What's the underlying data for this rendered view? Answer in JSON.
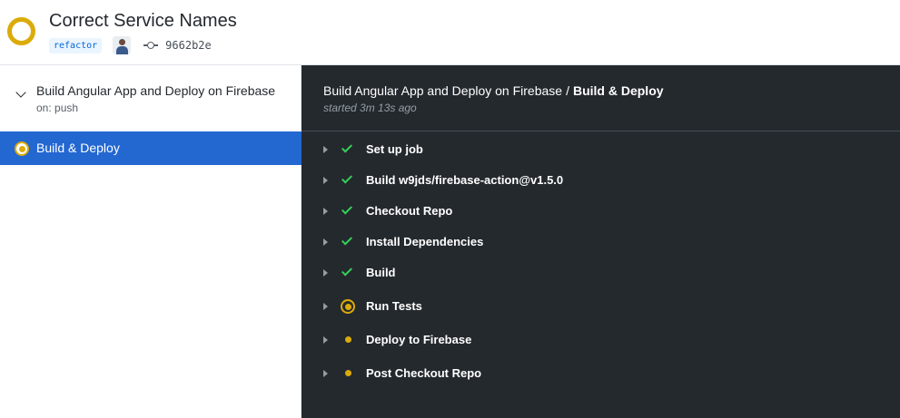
{
  "header": {
    "title": "Correct Service Names",
    "branch": "refactor",
    "commit_sha": "9662b2e",
    "status_icon": "in-progress-ring",
    "status_color": "#dbab09"
  },
  "sidebar": {
    "workflow_name": "Build Angular App and Deploy on Firebase",
    "trigger": "on: push",
    "jobs": [
      {
        "label": "Build & Deploy",
        "status": "in-progress",
        "selected": true
      }
    ]
  },
  "main": {
    "breadcrumb_workflow": "Build Angular App and Deploy on Firebase",
    "breadcrumb_separator": "/",
    "breadcrumb_job": "Build & Deploy",
    "started": "started 3m 13s ago",
    "steps": [
      {
        "label": "Set up job",
        "status": "success"
      },
      {
        "label": "Build w9jds/firebase-action@v1.5.0",
        "status": "success"
      },
      {
        "label": "Checkout Repo",
        "status": "success"
      },
      {
        "label": "Install Dependencies",
        "status": "success"
      },
      {
        "label": "Build",
        "status": "success"
      },
      {
        "label": "Run Tests",
        "status": "in-progress"
      },
      {
        "label": "Deploy to Firebase",
        "status": "queued"
      },
      {
        "label": "Post Checkout Repo",
        "status": "queued"
      }
    ]
  },
  "colors": {
    "accent": "#f66a0a",
    "selected_bg": "#2367d1",
    "main_bg": "#24292e",
    "success": "#34d058",
    "in_progress": "#dbab09"
  }
}
